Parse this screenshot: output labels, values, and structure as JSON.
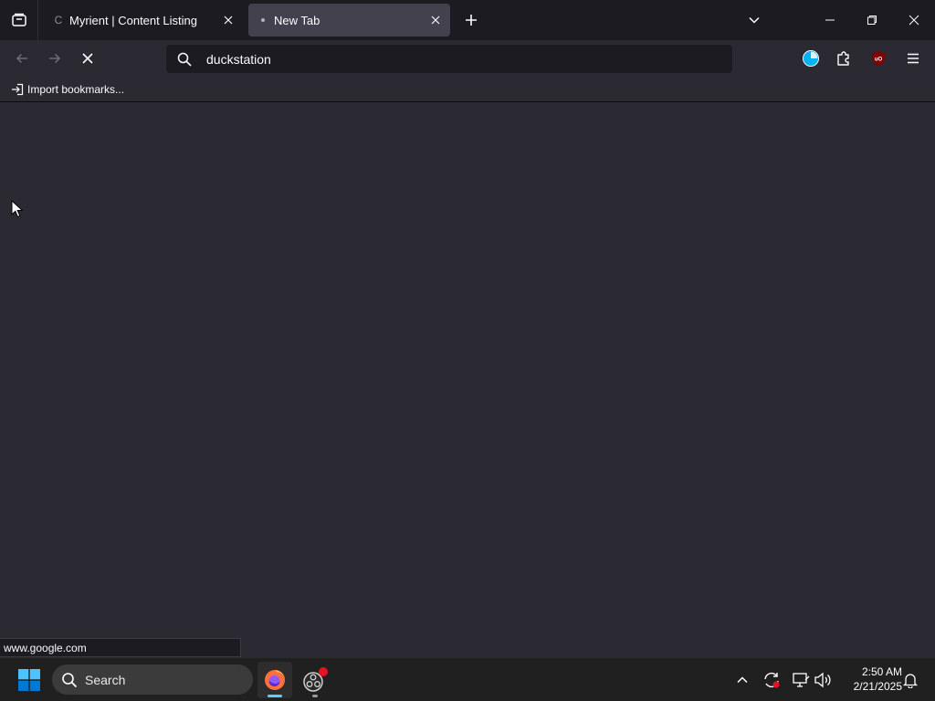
{
  "browser": {
    "tabs": [
      {
        "title": "Myrient | Content Listing",
        "favicon": "loading-c",
        "active": false
      },
      {
        "title": "New Tab",
        "favicon": "dot",
        "active": true
      }
    ],
    "urlbar": {
      "value": "duckstation"
    },
    "bookmarks": {
      "import_label": "Import bookmarks..."
    },
    "status": "www.google.com",
    "icons": {
      "tab_list": "tab-list-icon",
      "back": "back-arrow-icon",
      "forward": "forward-arrow-icon",
      "stop": "stop-icon",
      "account": "account-icon",
      "extensions": "puzzle-piece-icon",
      "ublock": "ublock-icon",
      "menu": "hamburger-menu-icon"
    },
    "colors": {
      "accent": "#00b3f4",
      "ublock_red": "#800000",
      "tab_active_bg": "#42414d"
    }
  },
  "taskbar": {
    "search_label": "Search",
    "time": "2:50 AM",
    "date": "2/21/2025",
    "colors": {
      "start_blue": "#0078d4",
      "firefox_orange": "#ff7139",
      "active_indicator": "#60cdff"
    }
  }
}
